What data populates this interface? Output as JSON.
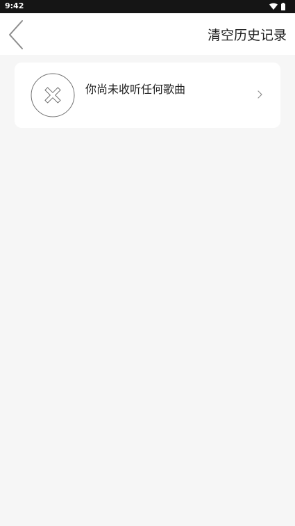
{
  "status_bar": {
    "time": "9:42",
    "icons": [
      "wifi-icon",
      "battery-icon"
    ]
  },
  "header": {
    "back_icon": "chevron-left-icon",
    "clear_history_label": "清空历史记录"
  },
  "history": {
    "empty_message": "你尚未收听任何歌曲",
    "empty_icon": "close-circle-icon",
    "chevron_icon": "chevron-right-icon"
  },
  "colors": {
    "background": "#f6f6f6",
    "status_bar": "#151515",
    "header_bg": "#ffffff",
    "card_bg": "#ffffff",
    "text_primary": "#1f1f1f",
    "icon_gray": "#8c8c8c"
  }
}
